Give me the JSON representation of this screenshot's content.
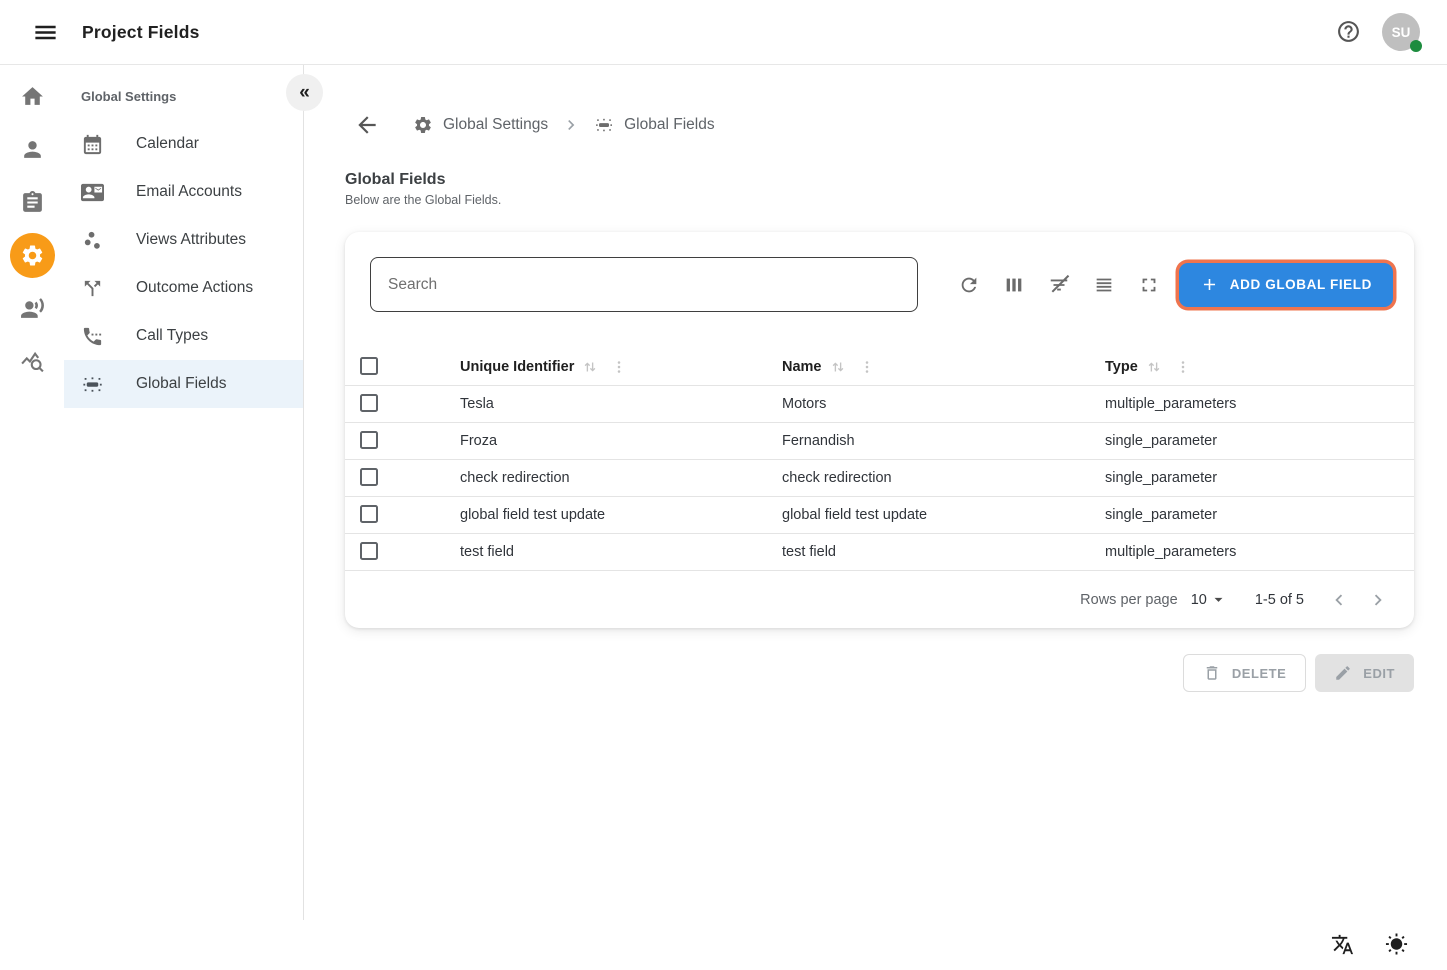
{
  "topbar": {
    "title": "Project Fields",
    "avatar_initials": "SU"
  },
  "rail": {
    "items": [
      "home",
      "contacts",
      "tasks",
      "settings",
      "coaching",
      "analytics"
    ],
    "active_item": "settings"
  },
  "sidebar": {
    "heading": "Global Settings",
    "items": [
      {
        "label": "Calendar",
        "icon": "calendar-icon",
        "selected": false
      },
      {
        "label": "Email Accounts",
        "icon": "contact-mail-icon",
        "selected": false
      },
      {
        "label": "Views Attributes",
        "icon": "scatter-plot-icon",
        "selected": false
      },
      {
        "label": "Outcome Actions",
        "icon": "call-split-icon",
        "selected": false
      },
      {
        "label": "Call Types",
        "icon": "settings-phone-icon",
        "selected": false
      },
      {
        "label": "Global Fields",
        "icon": "blur-linear-icon",
        "selected": true
      }
    ]
  },
  "breadcrumb": {
    "parent": "Global Settings",
    "current": "Global Fields"
  },
  "page": {
    "title": "Global Fields",
    "subtitle": "Below are the Global Fields."
  },
  "toolbar": {
    "search_placeholder": "Search",
    "add_button_label": "ADD GLOBAL FIELD",
    "icons": [
      "refresh-icon",
      "columns-icon",
      "filter-off-icon",
      "density-icon",
      "fullscreen-icon"
    ]
  },
  "table": {
    "columns": [
      "Unique Identifier",
      "Name",
      "Type"
    ],
    "rows": [
      {
        "unique_identifier": "Tesla",
        "name": "Motors",
        "type": "multiple_parameters"
      },
      {
        "unique_identifier": "Froza",
        "name": "Fernandish",
        "type": "single_parameter"
      },
      {
        "unique_identifier": "check redirection",
        "name": "check redirection",
        "type": "single_parameter"
      },
      {
        "unique_identifier": "global field test update",
        "name": "global field test update",
        "type": "single_parameter"
      },
      {
        "unique_identifier": "test field",
        "name": "test field",
        "type": "multiple_parameters"
      }
    ],
    "pagination": {
      "rows_per_page_label": "Rows per page",
      "rows_per_page_value": "10",
      "range_label": "1-5 of 5"
    }
  },
  "actions": {
    "delete_label": "DELETE",
    "edit_label": "EDIT"
  },
  "colors": {
    "accent_blue": "#2D87E0",
    "focus_ring_orange": "#EF744E",
    "active_nav_orange": "#F89B18",
    "selected_item_bg": "#EBF3FA",
    "online_green": "#1D8C3F"
  }
}
